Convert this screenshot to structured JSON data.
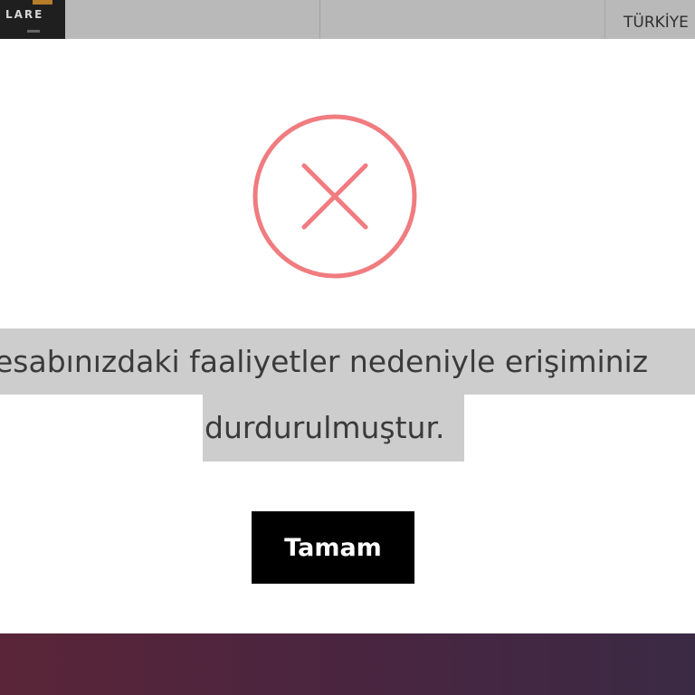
{
  "header": {
    "logo_text": "LARE",
    "country": "TÜRKİYE"
  },
  "modal": {
    "icon": "error-x-circle-icon",
    "message_line1": "esabınızdaki faaliyetler nedeniyle erişiminiz",
    "message_line2": "durdurulmuştur.",
    "button_label": "Tamam"
  },
  "colors": {
    "icon": "#f07c80",
    "button_bg": "#000000",
    "button_text": "#ffffff",
    "highlight": "#cdcdcd",
    "footer_start": "#5a2538",
    "footer_end": "#3b2a44"
  }
}
